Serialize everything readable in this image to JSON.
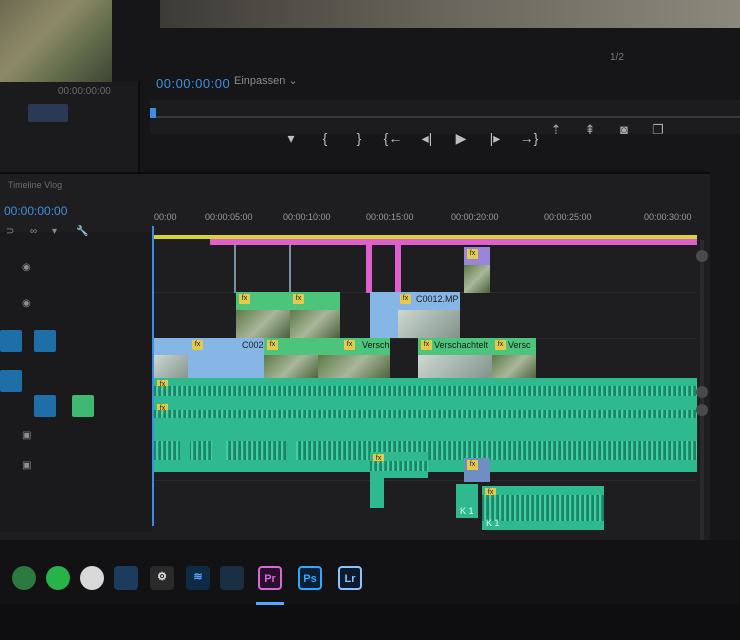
{
  "program_monitor": {
    "timecode": "00:00:00:00",
    "fit_select": "Einpassen",
    "fraction": "1/2",
    "source_small_timecode": "00:00:00:00"
  },
  "transport": {
    "buttons": [
      "marker-icon",
      "in-point-icon",
      "out-point-icon",
      "go-to-in-icon",
      "step-back-icon",
      "play-icon",
      "step-forward-icon",
      "go-to-out-icon"
    ],
    "extra": [
      "lift-icon",
      "extract-icon",
      "export-frame-icon",
      "compare-icon"
    ]
  },
  "timeline": {
    "sequence_name": "Timeline Vlog",
    "timecode": "00:00:00:00",
    "ruler": [
      "00:00",
      "00:00:05:00",
      "00:00:10:00",
      "00:00:15:00",
      "00:00:20:00",
      "00:00:25:00",
      "00:00:30:00"
    ],
    "clips": {
      "c0012": "C0012.MP",
      "c0024": "C0024",
      "versch_a": "Versch",
      "versch_b": "Verschachtelt",
      "versch_c": "Versc",
      "k1_a": "K 1",
      "k1_b": "K 1"
    },
    "fx": "fx"
  },
  "taskbar": {
    "apps": [
      "Pr",
      "Ps",
      "Lr"
    ]
  },
  "colors": {
    "accent_timecode": "#3f8fe0",
    "video_clip_green": "#4cc47c",
    "video_clip_blue": "#86b6e6",
    "video_clip_lavender": "#9a86d8",
    "audio_clip": "#2fb98f",
    "work_area_yellow": "#d6d43a",
    "marker_pink": "#e05fcf"
  }
}
